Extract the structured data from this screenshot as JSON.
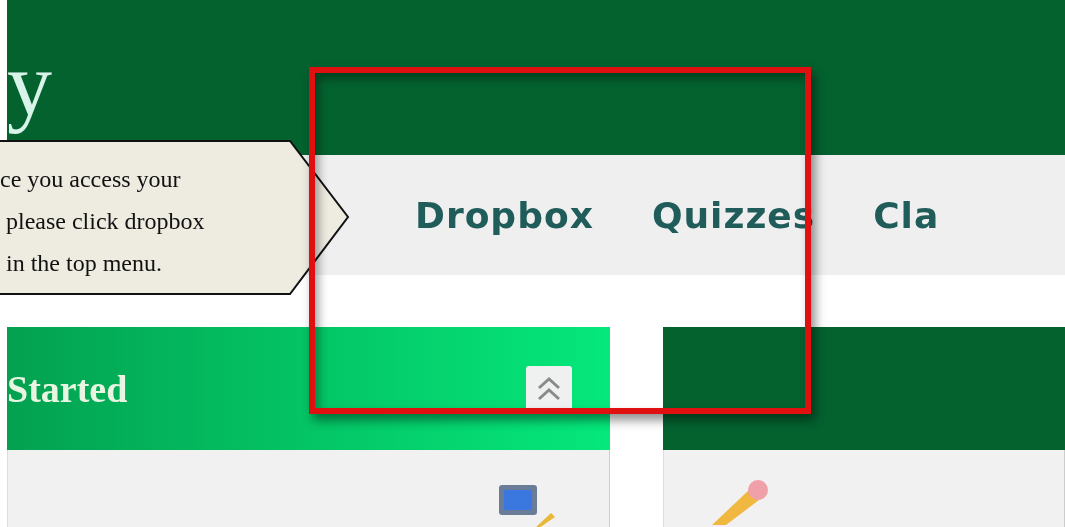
{
  "logo": {
    "text": "y"
  },
  "menu": {
    "items": [
      {
        "label": "Dropbox"
      },
      {
        "label": "Quizzes"
      },
      {
        "label": "Cla"
      }
    ]
  },
  "panels": [
    {
      "kind": "highlighted",
      "title": "Started"
    },
    {
      "kind": "plain"
    }
  ],
  "callout": {
    "text": "ce you access your\n please click dropbox\n in the top menu."
  }
}
